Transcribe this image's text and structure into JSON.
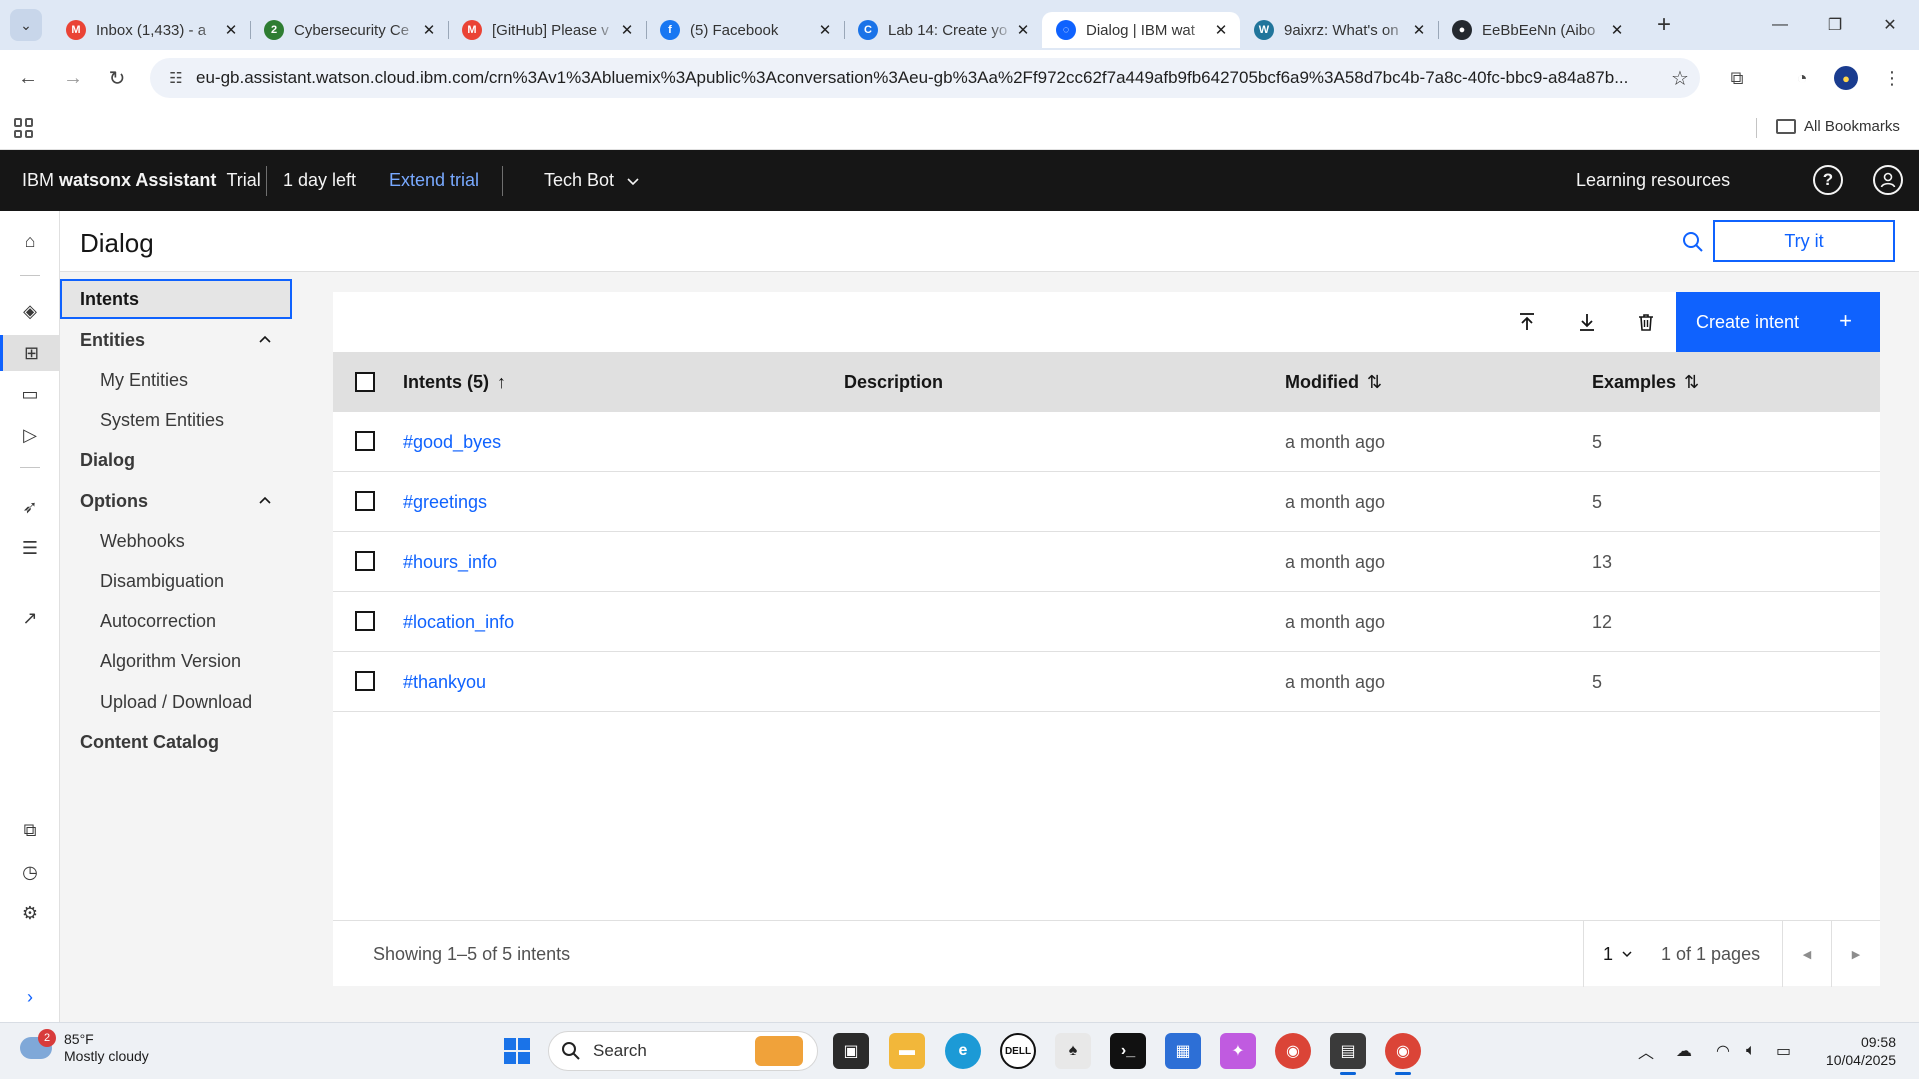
{
  "browser": {
    "tabs": [
      {
        "label": "Inbox (1,433) - a",
        "icon": "gmail-icon",
        "color": "#ea4335",
        "glyph": "M",
        "active": false
      },
      {
        "label": "Cybersecurity Ce",
        "icon": "badge-icon",
        "color": "#2e7d32",
        "glyph": "2",
        "active": false
      },
      {
        "label": "[GitHub] Please v",
        "icon": "gmail-icon",
        "color": "#ea4335",
        "glyph": "M",
        "active": false
      },
      {
        "label": "(5) Facebook",
        "icon": "facebook-icon",
        "color": "#1877f2",
        "glyph": "f",
        "active": false
      },
      {
        "label": "Lab 14: Create yo",
        "icon": "course-icon",
        "color": "#1a73e8",
        "glyph": "C",
        "active": false
      },
      {
        "label": "Dialog | IBM wat",
        "icon": "watson-icon",
        "color": "#0f62fe",
        "glyph": "◌",
        "active": true
      },
      {
        "label": "9aixrz: What's on",
        "icon": "wordpress-icon",
        "color": "#21759b",
        "glyph": "W",
        "active": false
      },
      {
        "label": "EeBbEeNn (Aibo",
        "icon": "github-icon",
        "color": "#24292f",
        "glyph": "●",
        "active": false
      }
    ],
    "url": "eu-gb.assistant.watson.cloud.ibm.com/crn%3Av1%3Abluemix%3Apublic%3Aconversation%3Aeu-gb%3Aa%2Ff972cc62f7a449afb9fb642705bcf6a9%3A58d7bc4b-7a8c-40fc-bbc9-a84a87b...",
    "bookmarks_label": "All Bookmarks"
  },
  "header": {
    "brand_prefix": "IBM ",
    "brand_name": "watsonx Assistant",
    "plan": "Trial",
    "days_left": "1 day left",
    "extend": "Extend trial",
    "assistant_name": "Tech Bot",
    "learning": "Learning resources"
  },
  "page": {
    "title": "Dialog",
    "try_it": "Try it"
  },
  "subnav": [
    {
      "label": "Intents",
      "level": 1,
      "selected": true
    },
    {
      "label": "Entities",
      "level": 1,
      "expanded": true
    },
    {
      "label": "My Entities",
      "level": 2
    },
    {
      "label": "System Entities",
      "level": 2
    },
    {
      "label": "Dialog",
      "level": 1
    },
    {
      "label": "Options",
      "level": 1,
      "expanded": true
    },
    {
      "label": "Webhooks",
      "level": 2
    },
    {
      "label": "Disambiguation",
      "level": 2
    },
    {
      "label": "Autocorrection",
      "level": 2
    },
    {
      "label": "Algorithm Version",
      "level": 2
    },
    {
      "label": "Upload / Download",
      "level": 2
    },
    {
      "label": "Content Catalog",
      "level": 1
    }
  ],
  "table": {
    "create_label": "Create intent",
    "columns": {
      "intents": "Intents (5)",
      "description": "Description",
      "modified": "Modified",
      "examples": "Examples"
    },
    "rows": [
      {
        "intent": "#good_byes",
        "description": "",
        "modified": "a month ago",
        "examples": "5"
      },
      {
        "intent": "#greetings",
        "description": "",
        "modified": "a month ago",
        "examples": "5"
      },
      {
        "intent": "#hours_info",
        "description": "",
        "modified": "a month ago",
        "examples": "13"
      },
      {
        "intent": "#location_info",
        "description": "",
        "modified": "a month ago",
        "examples": "12"
      },
      {
        "intent": "#thankyou",
        "description": "",
        "modified": "a month ago",
        "examples": "5"
      }
    ],
    "pagination": {
      "showing": "Showing 1–5 of 5 intents",
      "page": "1",
      "of_pages": "1 of 1 pages"
    }
  },
  "taskbar": {
    "weather_badge": "2",
    "temperature": "85°F",
    "condition": "Mostly cloudy",
    "search_label": "Search",
    "time": "09:58",
    "date": "10/04/2025"
  },
  "colors": {
    "ibm_blue": "#0f62fe",
    "header_bg": "#161616",
    "link_blue": "#78a9ff"
  }
}
